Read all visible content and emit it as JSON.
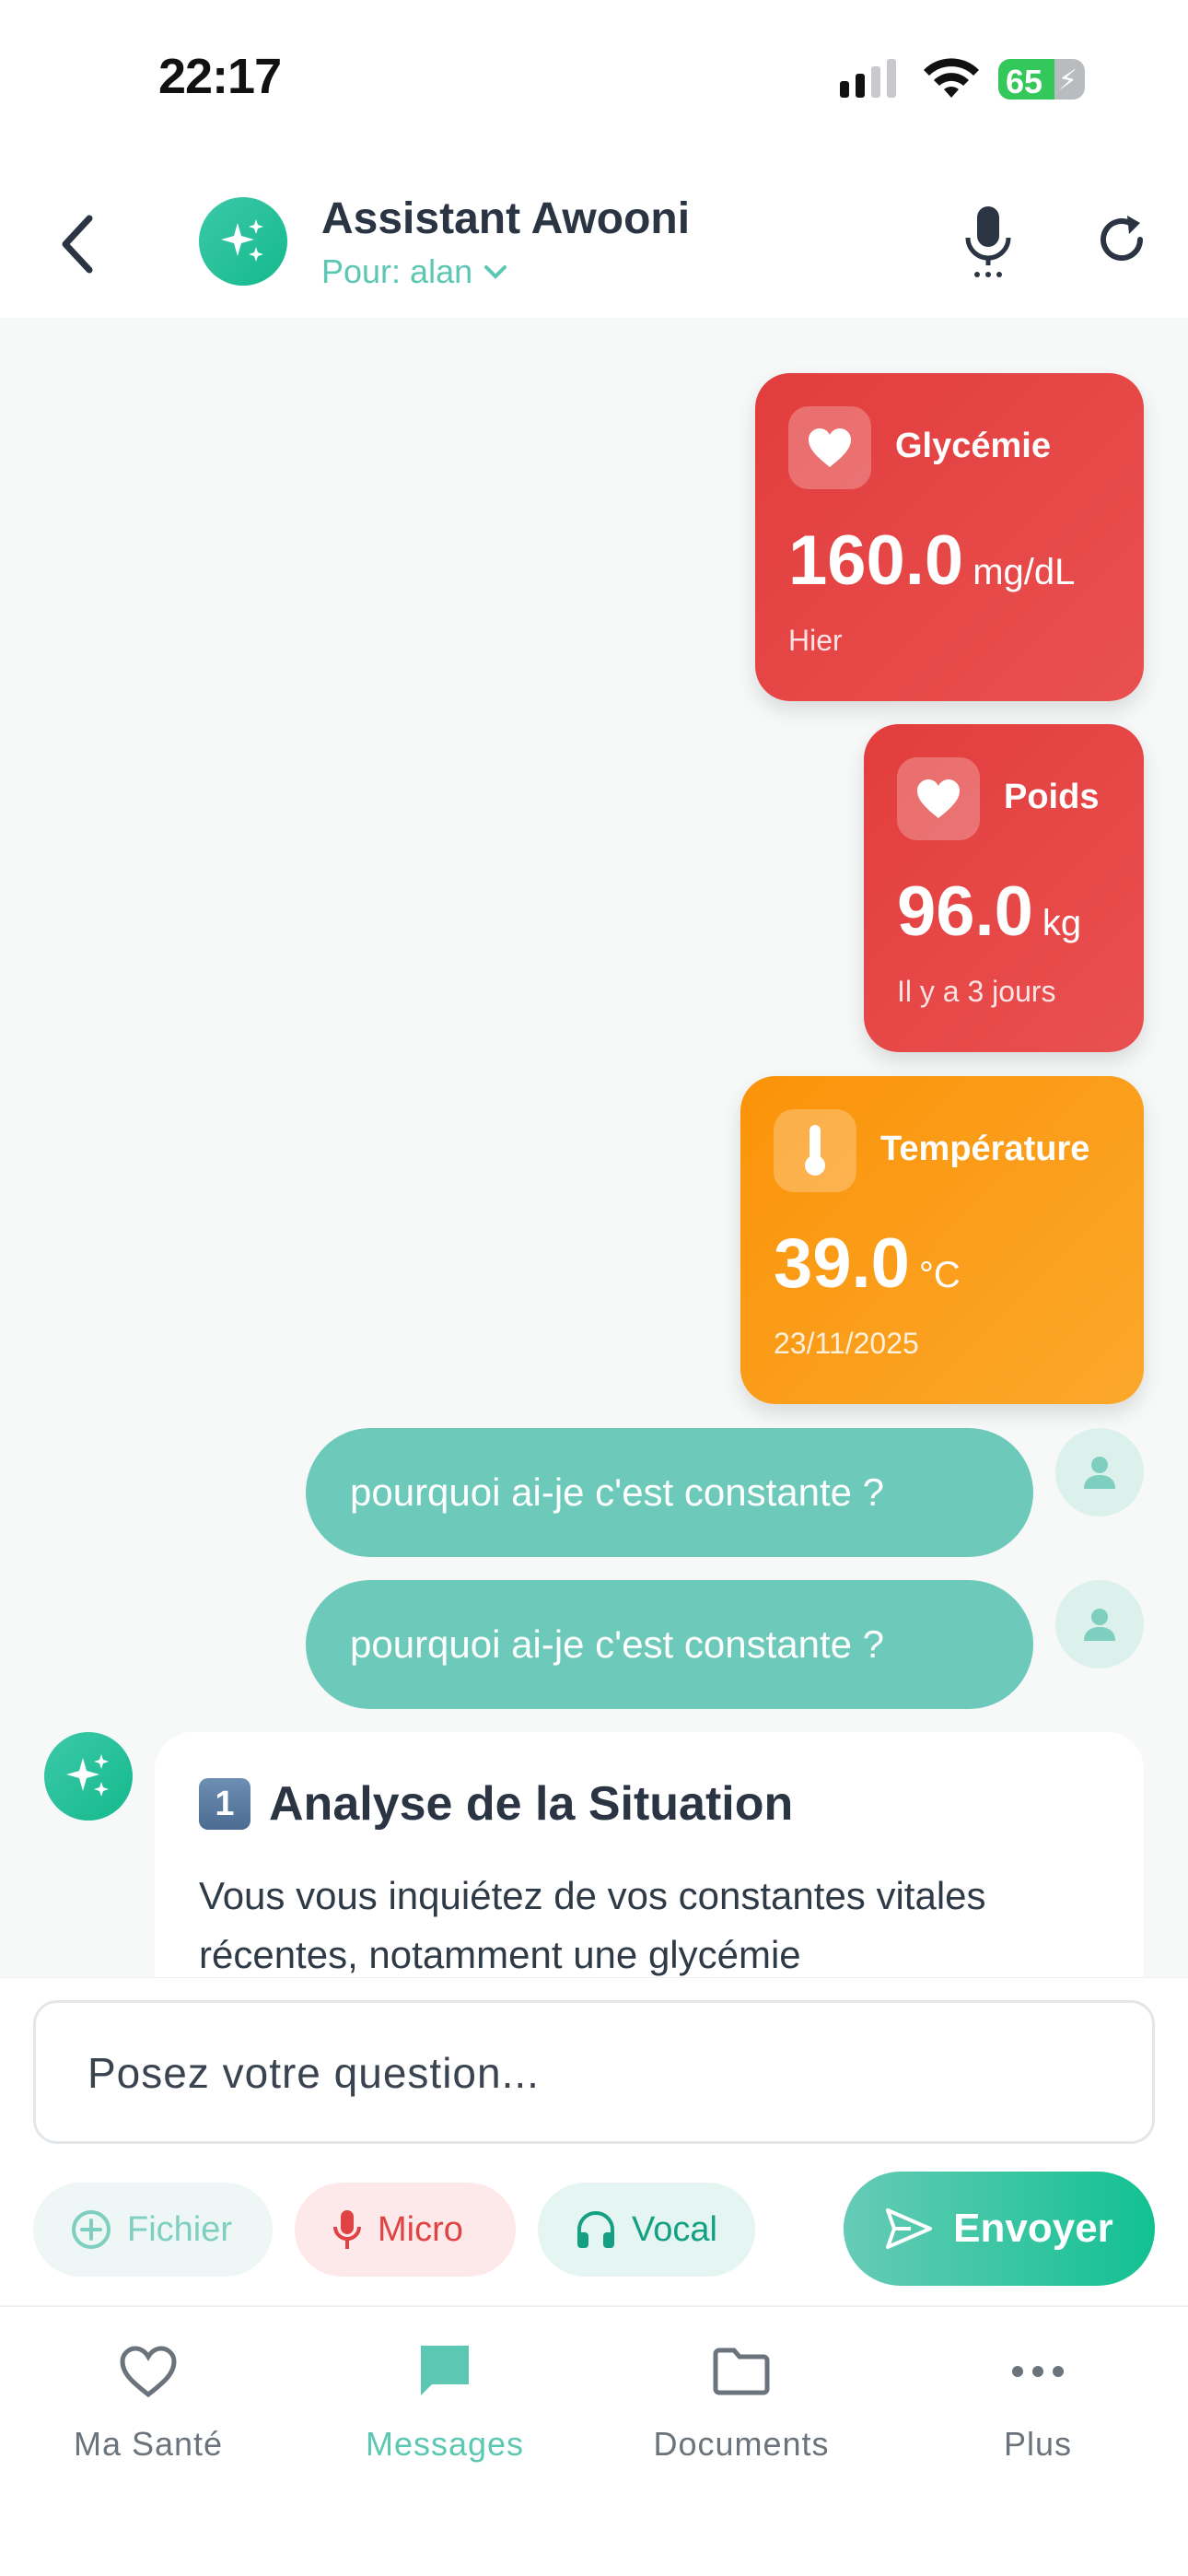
{
  "status_bar": {
    "time": "22:17",
    "battery": "65",
    "battery_level": 0.65
  },
  "header": {
    "title": "Assistant Awooni",
    "subtitle": "Pour: alan"
  },
  "vitals": [
    {
      "label": "Glycémie",
      "value": "160.0",
      "unit": "mg/dL",
      "when": "Hier",
      "icon": "heart-icon",
      "color": "#e23d3d"
    },
    {
      "label": "Poids",
      "value": "96.0",
      "unit": "kg",
      "when": "Il y a 3 jours",
      "icon": "heart-icon",
      "color": "#e23d3d"
    },
    {
      "label": "Température",
      "value": "39.0",
      "unit": "°C",
      "when": "23/11/2025",
      "icon": "thermometer-icon",
      "color": "#fb9309"
    }
  ],
  "messages": [
    {
      "text": "pourquoi ai-je c'est constante ?"
    },
    {
      "text": "pourquoi ai-je c'est constante ?"
    }
  ],
  "ai_response": {
    "heading_key": "1",
    "heading": "Analyse de la Situation",
    "body": "Vous vous inquiétez de vos constantes vitales récentes, notamment une glycémie"
  },
  "composer": {
    "placeholder": "Posez votre question...",
    "file_label": "Fichier",
    "micro_label": "Micro",
    "vocal_label": "Vocal",
    "send_label": "Envoyer"
  },
  "nav": {
    "items": [
      {
        "label": "Ma Santé"
      },
      {
        "label": "Messages"
      },
      {
        "label": "Documents"
      },
      {
        "label": "Plus"
      }
    ],
    "active": "Messages"
  },
  "colors": {
    "accent": "#5cc7b2",
    "user_bubble": "#6dc9b9",
    "send_gradient_end": "#12c192"
  }
}
